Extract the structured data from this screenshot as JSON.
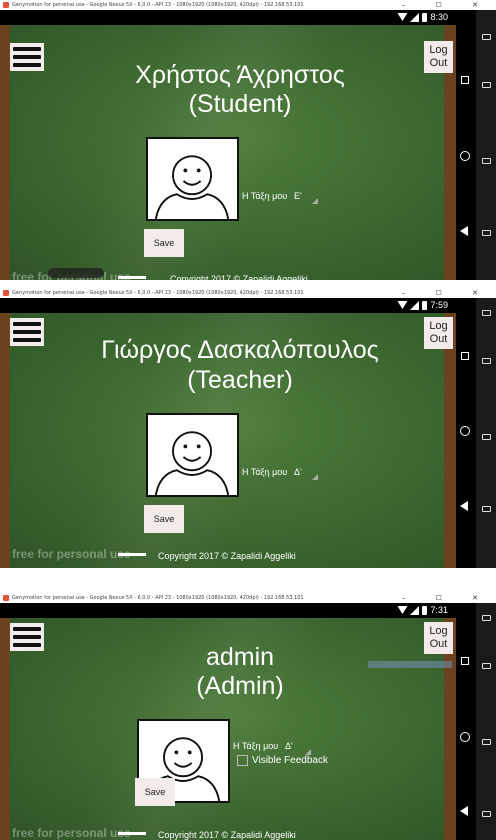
{
  "app": {
    "emulator_title": "Genymotion for personal use - Google Nexus 5X - 6.0.0 - API 23 - 1080x1920 (1080x1920, 420dpi) - 192.168.53.101",
    "window_controls": "– ☐ ✕",
    "watermark": "free for personal use",
    "footer_text": "Copyright 2017 ©    Zapalidi Aggeliki",
    "logout_label": "Log\nOut",
    "save_label": "Save",
    "class_label": "Η Τάξη μου"
  },
  "screens": [
    {
      "time": "8:30",
      "name": "Χρήστος Άχρηστος",
      "role": "(Student)",
      "class_value": "Ε'"
    },
    {
      "time": "7:59",
      "name": "Γιώργος Δασκαλόπουλος",
      "role": "(Teacher)",
      "class_value": "Δ'"
    },
    {
      "time": "7:31",
      "name": "admin",
      "role": "(Admin)",
      "class_value": "Δ'",
      "feedback_label": "Visible Feedback"
    }
  ],
  "icons": [
    "menu-icon",
    "wifi-icon",
    "signal-icon",
    "battery-icon",
    "back-icon",
    "home-icon",
    "recents-icon",
    "avatar-face"
  ],
  "colors": {
    "board": "#3f6b31",
    "frame": "#6b4220",
    "button_bg": "#f3eaea"
  }
}
